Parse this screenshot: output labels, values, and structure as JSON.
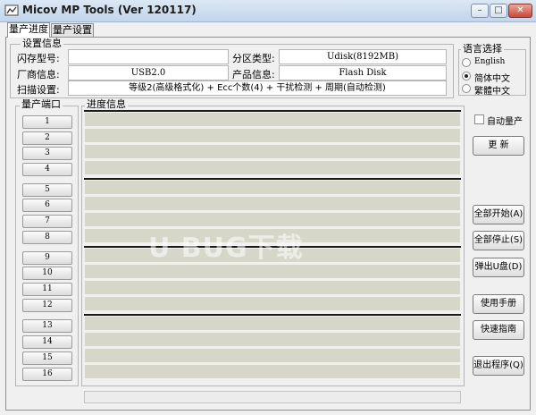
{
  "window": {
    "title": "Micov MP Tools (Ver 120117)",
    "minimize_glyph": "–",
    "maximize_glyph": "□",
    "close_glyph": "✕"
  },
  "tabs": [
    {
      "label": "量产进度",
      "active": true
    },
    {
      "label": "量产设置",
      "active": false
    }
  ],
  "settings_info": {
    "title": "设置信息",
    "flash_model_label": "闪存型号:",
    "flash_model_value": "",
    "partition_type_label": "分区类型:",
    "partition_type_value": "Udisk(8192MB)",
    "vendor_info_label": "厂商信息:",
    "vendor_info_value": "USB2.0",
    "product_info_label": "产品信息:",
    "product_info_value": "Flash Disk",
    "scan_settings_label": "扫描设置:",
    "scan_settings_value": "等级2(高级格式化) + Ecc个数(4) + 干扰检测 + 周期(自动检测)"
  },
  "language": {
    "title": "语言选择",
    "options": [
      {
        "label": "English",
        "selected": false
      },
      {
        "label": "简体中文",
        "selected": true
      },
      {
        "label": "繁體中文",
        "selected": false
      }
    ]
  },
  "ports": {
    "title": "量产端口",
    "items": [
      "1",
      "2",
      "3",
      "4",
      "5",
      "6",
      "7",
      "8",
      "9",
      "10",
      "11",
      "12",
      "13",
      "14",
      "15",
      "16"
    ]
  },
  "progress": {
    "title": "进度信息"
  },
  "right_panel": {
    "auto_production_label": "自动量产",
    "auto_production_checked": false,
    "refresh_label": "更  新",
    "start_all_label": "全部开始(A)",
    "stop_all_label": "全部停止(S)",
    "eject_label": "弹出U盘(D)",
    "manual_label": "使用手册",
    "quick_guide_label": "快速指南",
    "exit_label": "退出程序(Q)"
  },
  "watermark": "U BUG下载"
}
